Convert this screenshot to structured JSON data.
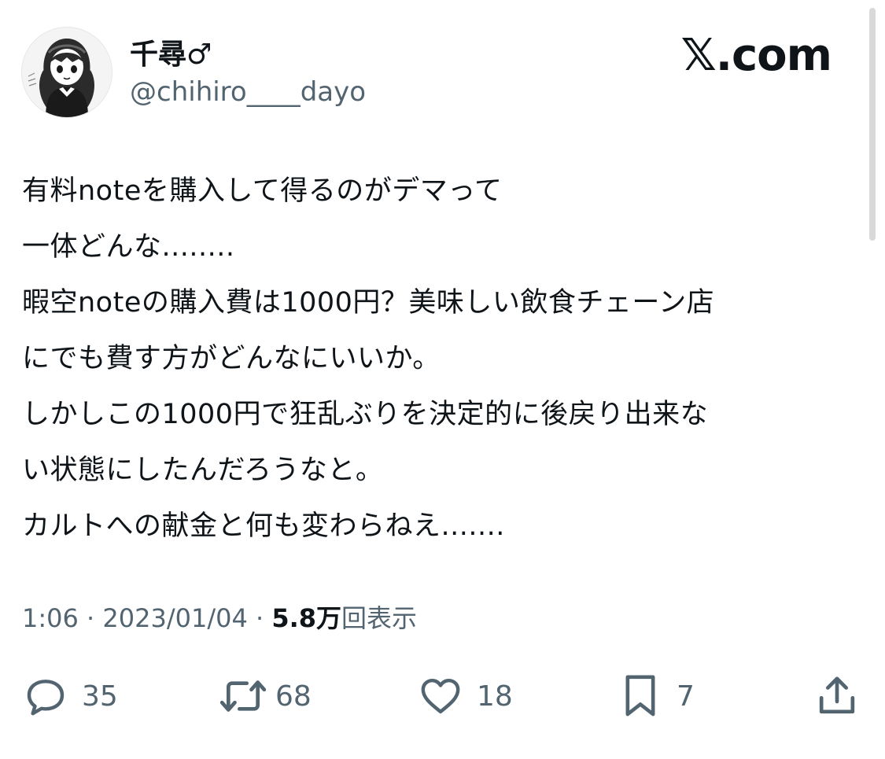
{
  "author": {
    "display_name": "千尋♂",
    "handle": "@chihiro____dayo",
    "avatar_icon": "avatar-illustration-icon"
  },
  "brand": {
    "logo_text": "𝕏.com"
  },
  "tweet": {
    "lines": [
      "有料noteを購入して得るのがデマって",
      "一体どんな........",
      "暇空noteの購入費は1000円？美味しい飲食チェーン店",
      "にでも費す方がどんなにいいか。",
      "しかしこの1000円で狂乱ぶりを決定的に後戻り出来な",
      "い状態にしたんだろうなと。",
      "カルトへの献金と何も変わらねえ......."
    ]
  },
  "meta": {
    "time": "1:06",
    "separator": " · ",
    "date": "2023/01/04",
    "views_count": "5.8万",
    "views_label": "回表示"
  },
  "actions": {
    "reply": {
      "icon": "reply-icon",
      "count": "35"
    },
    "repost": {
      "icon": "repost-icon",
      "count": "68"
    },
    "like": {
      "icon": "heart-icon",
      "count": "18"
    },
    "bookmark": {
      "icon": "bookmark-icon",
      "count": "7"
    },
    "share": {
      "icon": "share-icon"
    }
  },
  "colors": {
    "text_primary": "#0f1419",
    "text_secondary": "#536471",
    "background": "#ffffff"
  }
}
